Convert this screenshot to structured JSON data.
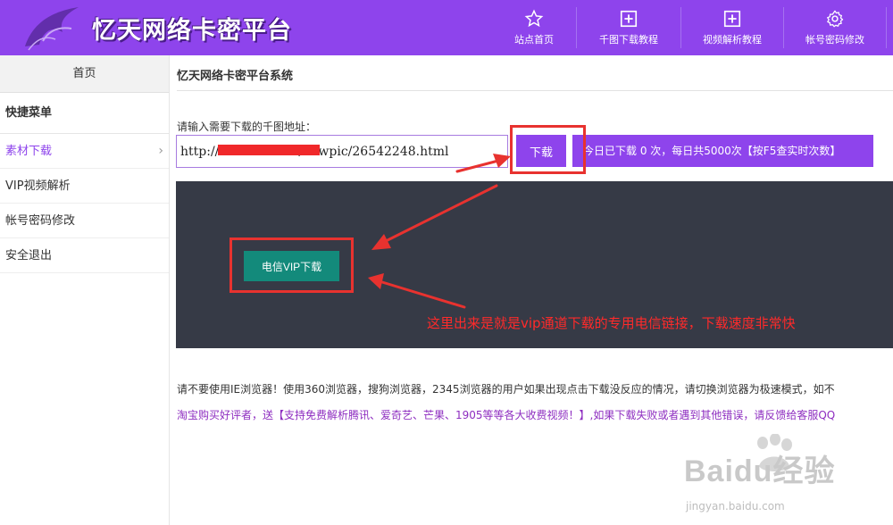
{
  "header": {
    "brand": "忆天网络卡密平台",
    "nav": [
      {
        "label": "站点首页",
        "icon": "star-icon"
      },
      {
        "label": "千图下载教程",
        "icon": "plus-square-icon"
      },
      {
        "label": "视频解析教程",
        "icon": "plus-square-icon"
      },
      {
        "label": "帐号密码修改",
        "icon": "gear-icon"
      }
    ]
  },
  "sidebar": {
    "home": "首页",
    "section_title": "快捷菜单",
    "items": [
      {
        "label": "素材下载"
      },
      {
        "label": "VIP视频解析"
      },
      {
        "label": "帐号密码修改"
      },
      {
        "label": "安全退出"
      }
    ]
  },
  "main": {
    "title": "忆天网络卡密平台系统",
    "url_label": "请输入需要下载的千图地址：",
    "url_value": "http://                    /newpic/26542248.html",
    "download_button": "下载",
    "count_text": "今日已下载 0 次，每日共5000次【按F5查实时次数】",
    "vip_button": "电信VIP下载",
    "annotation": "这里出来是就是vip通道下载的专用电信链接，下载速度非常快",
    "notice_1": "请不要使用IE浏览器！使用360浏览器，搜狗浏览器，2345浏览器的用户如果出现点击下载没反应的情况，请切换浏览器为极速模式，如不",
    "notice_2": "淘宝购买好评者，送【支持免费解析腾讯、爱奇艺、芒果、1905等等各大收费视频！】,如果下载失败或者遇到其他错误，请反馈给客服QQ"
  },
  "watermark": {
    "brand": "Baidu经验",
    "url": "jingyan.baidu.com"
  },
  "colors": {
    "primary": "#8e44ec",
    "vip_button": "#138a7b",
    "panel": "#363a46",
    "annotation_red": "#e8322f"
  }
}
